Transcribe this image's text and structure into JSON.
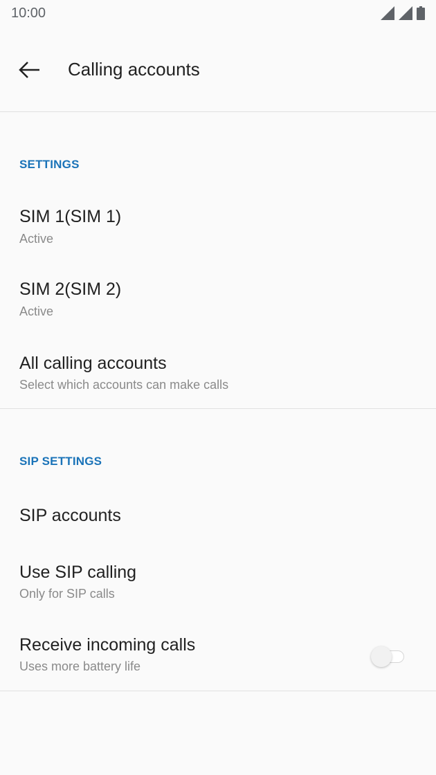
{
  "status_bar": {
    "time": "10:00",
    "icons": [
      "signal-icon",
      "signal-icon",
      "battery-icon"
    ]
  },
  "header": {
    "back_icon": "arrow-back-icon",
    "title": "Calling accounts"
  },
  "sections": [
    {
      "header": "SETTINGS",
      "items": [
        {
          "title": "SIM 1(SIM 1)",
          "summary": "Active"
        },
        {
          "title": "SIM 2(SIM 2)",
          "summary": "Active"
        },
        {
          "title": "All calling accounts",
          "summary": "Select which accounts can make calls"
        }
      ]
    },
    {
      "header": "SIP SETTINGS",
      "items": [
        {
          "title": "SIP accounts",
          "summary": ""
        },
        {
          "title": "Use SIP calling",
          "summary": "Only for SIP calls"
        },
        {
          "title": "Receive incoming calls",
          "summary": "Uses more battery life",
          "toggle_on": false
        }
      ]
    }
  ],
  "colors": {
    "accent": "#1a73b8",
    "background": "#fafafa",
    "divider": "#e0e0e0"
  }
}
